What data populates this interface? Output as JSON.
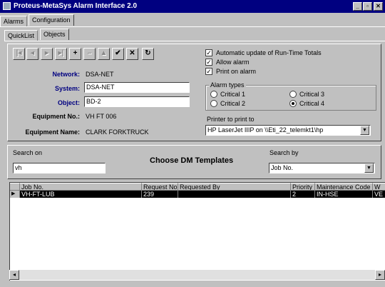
{
  "window": {
    "title": "Proteus-MetaSys Alarm Interface 2.0"
  },
  "titlebar_buttons": {
    "minimize": "_",
    "restore": "▫",
    "close": "✕"
  },
  "top_tabs": [
    {
      "label": "Alarms"
    },
    {
      "label": "Configuration"
    }
  ],
  "sub_tabs": [
    {
      "label": "QuickList"
    },
    {
      "label": "Objects"
    }
  ],
  "nav_toolbar": {
    "first": "|◂",
    "prev": "◂",
    "next": "▸",
    "last": "▸|",
    "add": "+",
    "delete": "–",
    "edit": "▲",
    "post": "✔",
    "cancel": "✕",
    "refresh": "↻"
  },
  "fields": {
    "network_label": "Network:",
    "network_value": "DSA-NET",
    "system_label": "System:",
    "system_value": "DSA-NET",
    "object_label": "Object:",
    "object_value": "BD-2",
    "equipment_no_label": "Equipment No.:",
    "equipment_no_value": "VH FT 006",
    "equipment_name_label": "Equipment Name:",
    "equipment_name_value": "CLARK FORKTRUCK"
  },
  "options": {
    "auto_update": {
      "label": "Automatic update of Run-Time Totals",
      "checked": true,
      "mark": "✓"
    },
    "allow_alarm": {
      "label": "Allow alarm",
      "checked": true,
      "mark": "✓"
    },
    "print_on_alarm": {
      "label": "Print on alarm",
      "checked": true,
      "mark": "✓"
    }
  },
  "alarm_types": {
    "title": "Alarm types",
    "items": [
      {
        "label": "Critical 1",
        "selected": false
      },
      {
        "label": "Critical 2",
        "selected": false
      },
      {
        "label": "Critical 3",
        "selected": false
      },
      {
        "label": "Critical 4",
        "selected": true
      }
    ]
  },
  "printer": {
    "label": "Printer to print to",
    "value": "HP LaserJet IIIP on \\\\Eti_22_telemkt1\\hp",
    "arrow": "▼"
  },
  "search": {
    "search_on_label": "Search on",
    "search_on_value": "vh",
    "heading": "Choose DM Templates",
    "search_by_label": "Search by",
    "search_by_value": "Job No.",
    "arrow": "▼"
  },
  "grid": {
    "columns": [
      "Job No.",
      "Request No.",
      "Requested By",
      "Priority",
      "Maintenance Code",
      "W"
    ],
    "rows": [
      {
        "marker": "▶",
        "cells": [
          "VH-FT-LUB",
          "239",
          "",
          "2",
          "IN-HSE",
          "VE"
        ],
        "selected": true
      }
    ]
  },
  "scrollbar": {
    "left": "◂",
    "right": "▸"
  },
  "colors": {
    "titlebar": "#000080",
    "desktop": "#3a6fd0",
    "window_face": "#c0c0c0",
    "label_navy": "#000080"
  }
}
